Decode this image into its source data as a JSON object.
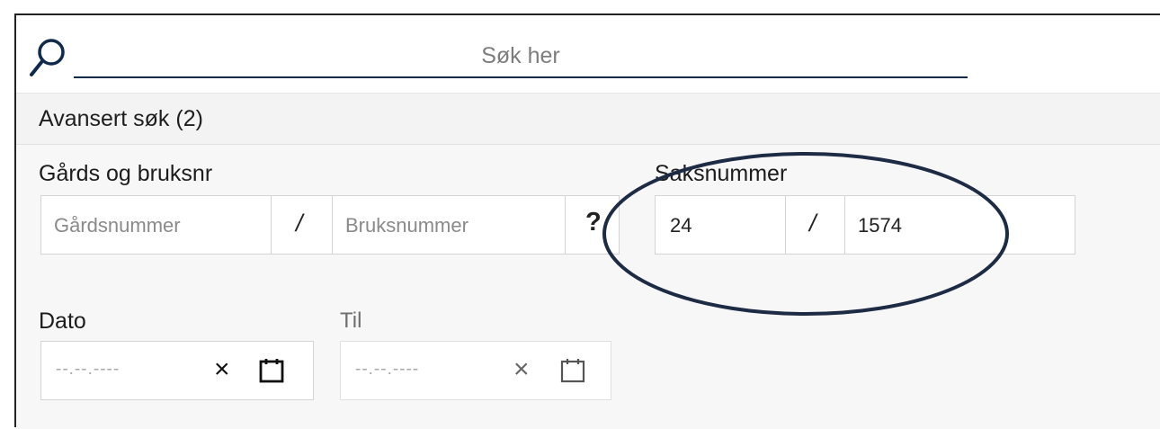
{
  "search": {
    "placeholder": "Søk her",
    "value": ""
  },
  "advanced": {
    "title": "Avansert søk (2)"
  },
  "gnr_bnr": {
    "label": "Gårds og bruksnr",
    "gards_placeholder": "Gårdsnummer",
    "separator": "/",
    "bruks_placeholder": "Bruksnummer",
    "help": "?"
  },
  "saksnummer": {
    "label": "Saksnummer",
    "year": "24",
    "separator": "/",
    "number": "1574"
  },
  "dato": {
    "label": "Dato",
    "placeholder": "--.--.----",
    "clear": "×"
  },
  "til": {
    "label": "Til",
    "placeholder": "--.--.----",
    "clear": "×"
  },
  "colors": {
    "accent": "#0f2a4a",
    "annotation": "#1d2b44"
  },
  "icons": [
    "search-icon",
    "calendar-icon",
    "clear-icon",
    "help-icon"
  ]
}
